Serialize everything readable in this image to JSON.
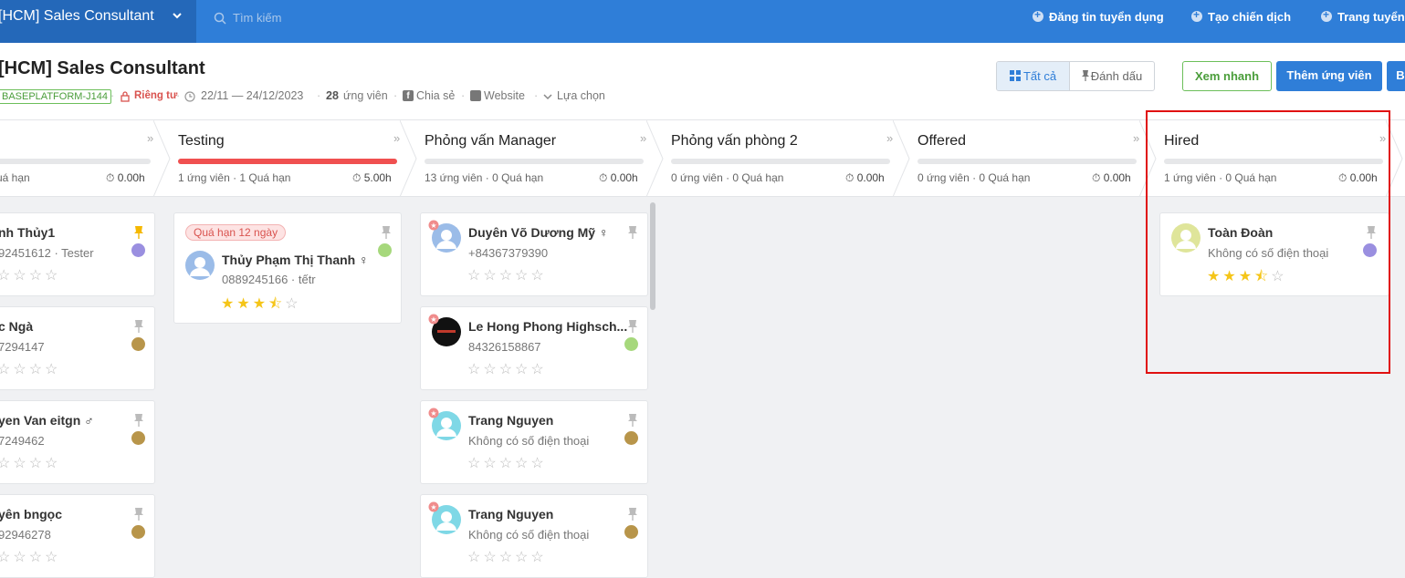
{
  "topbar": {
    "job_title": "[HCM] Sales Consultant",
    "search_placeholder": "Tìm kiếm",
    "links": [
      "Đăng tin tuyển dụng",
      "Tạo chiến dịch",
      "Trang tuyển d"
    ]
  },
  "header": {
    "title": "[HCM] Sales Consultant",
    "code": "BASEPLATFORM-J144",
    "privacy": "Riêng tư",
    "date_range": "22/11 — 24/12/2023",
    "candidate_count": "28",
    "candidate_label": "ứng viên",
    "share": "Chia sẻ",
    "website": "Website",
    "options": "Lựa chọn",
    "filter_all": "Tất cả",
    "filter_marked": "Đánh dấu",
    "quick_view": "Xem nhanh",
    "add_candidate": "Thêm ứng viên",
    "extra_btn": "B"
  },
  "colors": {
    "primary": "#2f7ed8",
    "topbar_dark": "#2468b9",
    "green": "#4a9d3a",
    "overdue": "#f05050",
    "star": "#f5c518",
    "highlight": "#e01010"
  },
  "columns": [
    {
      "name": "",
      "stat": "uá hạn",
      "hours": "0.00h"
    },
    {
      "name": "Testing",
      "stat": "1 ứng viên · 1 Quá hạn",
      "hours": "5.00h"
    },
    {
      "name": "Phỏng vấn Manager",
      "stat": "13 ứng viên · 0 Quá hạn",
      "hours": "0.00h"
    },
    {
      "name": "Phỏng vấn phòng 2",
      "stat": "0 ứng viên · 0 Quá hạn",
      "hours": "0.00h"
    },
    {
      "name": "Offered",
      "stat": "0 ứng viên · 0 Quá hạn",
      "hours": "0.00h"
    },
    {
      "name": "Hired",
      "stat": "1 ứng viên · 0 Quá hạn",
      "hours": "0.00h"
    }
  ],
  "cards": {
    "col0": [
      {
        "name": "nh Thủy1",
        "sub": "92451612 · Tester",
        "rating": 0
      },
      {
        "name": "c Ngà",
        "sub": "7294147",
        "rating": 0
      },
      {
        "name": "yen Van eitgn ♂",
        "sub": "7249462",
        "rating": 0
      },
      {
        "name": "yên bngọc",
        "sub": "92946278",
        "rating": 0
      }
    ],
    "testing": [
      {
        "overdue": "Quá hạn 12 ngày",
        "name": "Thủy Phạm Thị Thanh ♀",
        "sub": "0889245166 · tếtr",
        "rating": 3.5
      }
    ],
    "manager": [
      {
        "name": "Duyên Võ Dương Mỹ ♀",
        "sub": "+84367379390",
        "rating": 0
      },
      {
        "name": "Le Hong Phong Highsch...",
        "sub": "84326158867",
        "rating": 0
      },
      {
        "name": "Trang Nguyen",
        "sub": "Không có số điện thoại",
        "rating": 0
      },
      {
        "name": "Trang Nguyen",
        "sub": "Không có số điện thoại",
        "rating": 0
      }
    ],
    "hired": [
      {
        "name": "Toàn Đoàn",
        "sub": "Không có số điện thoại",
        "rating": 3.5
      }
    ]
  },
  "icons": [
    "chevron-down-icon",
    "search-icon",
    "plus-circle-icon",
    "grid-icon",
    "pin-icon",
    "lock-icon",
    "clock-icon",
    "facebook-icon",
    "external-link-icon",
    "timer-icon",
    "avatar-icon",
    "star-icon",
    "new-badge-icon"
  ]
}
